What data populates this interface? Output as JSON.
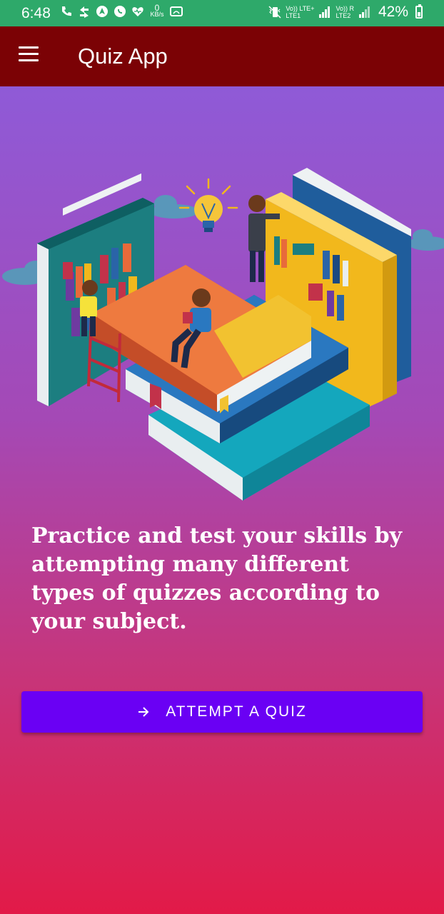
{
  "status_bar": {
    "time": "6:48",
    "data_speed_value": "0",
    "data_speed_unit": "KB/s",
    "sim1_label_top": "Vo)) LTE+",
    "sim1_label_bottom": "LTE1",
    "sim2_label_top": "Vo)) R",
    "sim2_label_bottom": "LTE2",
    "battery_percent": "42%",
    "battery_level": 0.42,
    "background": "#2ea96a"
  },
  "app_bar": {
    "title": "Quiz App",
    "menu_icon": "hamburger-menu-icon",
    "background": "#7b0205"
  },
  "main": {
    "illustration_icon": "books-and-students-illustration",
    "tagline": "Practice and test your skills by attempting many different types of quizzes according to your subject.",
    "cta_label": "ATTEMPT A QUIZ",
    "cta_icon": "arrow-right-icon",
    "cta_color": "#6a00f4",
    "gradient_top": "#8f5ad7",
    "gradient_bottom": "#e21a48"
  }
}
